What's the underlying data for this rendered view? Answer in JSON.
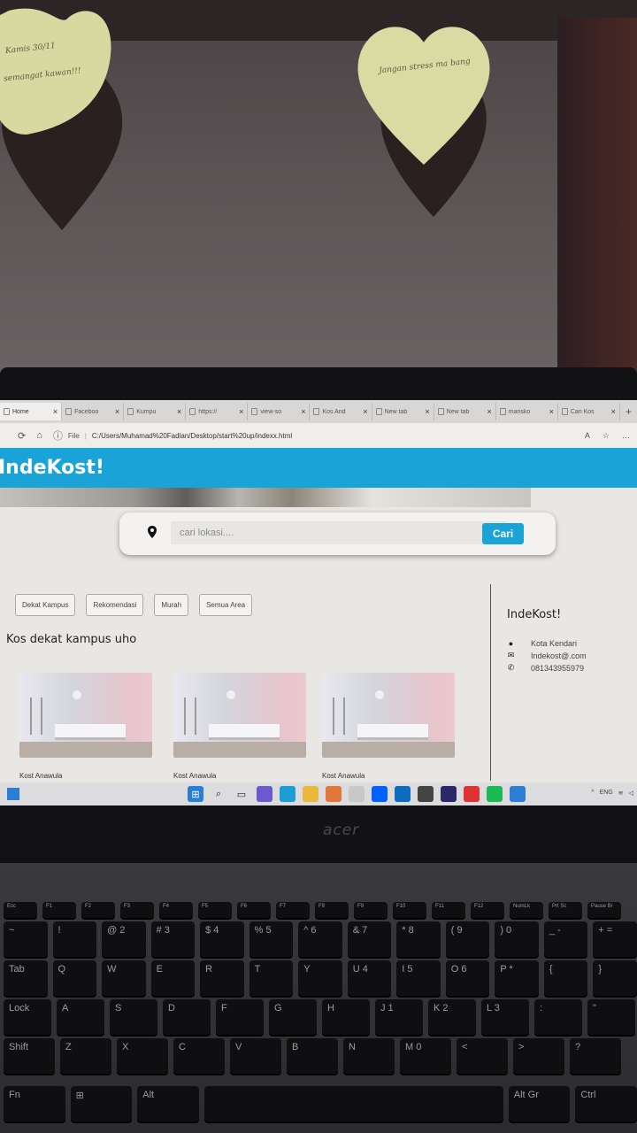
{
  "wall": {
    "note_left_line1": "Kamis 30/11",
    "note_left_line2": "semangat kawan!!!",
    "note_right": "Jangan stress ma bang"
  },
  "browser": {
    "tabs": [
      {
        "label": "Home",
        "active": true
      },
      {
        "label": "Faceboo"
      },
      {
        "label": "Kumpu"
      },
      {
        "label": "https://"
      },
      {
        "label": "view-so"
      },
      {
        "label": "Kos And"
      },
      {
        "label": "New tab"
      },
      {
        "label": "New tab"
      },
      {
        "label": "mansko"
      },
      {
        "label": "Cari Kos"
      }
    ],
    "new_tab_symbol": "+",
    "close_symbol": "×",
    "address": {
      "scheme_label": "File",
      "url": "C:/Users/Muhamad%20Fadlan/Desktop/start%20up/indexx.html"
    }
  },
  "site": {
    "brand": "IndeKost!",
    "search": {
      "placeholder": "cari lokasi....",
      "button": "Cari"
    },
    "filters": [
      "Dekat Kampus",
      "Rekomendasi",
      "Murah",
      "Semua Area"
    ],
    "section_title": "Kos dekat kampus uho",
    "cards": [
      {
        "name": "Kost Anawula"
      },
      {
        "name": "Kost Anawula"
      },
      {
        "name": "Kost Anawula"
      }
    ],
    "sidebar": {
      "brand": "IndeKost!",
      "location": "Kota Kendari",
      "email": "Indekost@.com",
      "phone": "081343955979"
    }
  },
  "taskbar": {
    "tray_lang": "ENG"
  },
  "laptop": {
    "logo": "acer",
    "keys_fn": [
      "Esc",
      "F1",
      "F2",
      "F3",
      "F4",
      "F5",
      "F6",
      "F7",
      "F8",
      "F9",
      "F10",
      "F11",
      "F12",
      "NumLk",
      "Prt Sc",
      "Pause Br"
    ],
    "keys_row1": [
      "~",
      "!",
      "@ 2",
      "# 3",
      "$ 4",
      "% 5",
      "^ 6",
      "& 7",
      "* 8",
      "( 9",
      ") 0",
      "_ -",
      "+ ="
    ],
    "keys_row2": [
      "Tab",
      "Q",
      "W",
      "E",
      "R",
      "T",
      "Y",
      "U 4",
      "I 5",
      "O 6",
      "P *",
      "{",
      "}"
    ],
    "keys_row3": [
      "Lock",
      "A",
      "S",
      "D",
      "F",
      "G",
      "H",
      "J 1",
      "K 2",
      "L 3",
      ":",
      "\""
    ],
    "keys_row4": [
      "Shift",
      "Z",
      "X",
      "C",
      "V",
      "B",
      "N",
      "M 0",
      "<",
      ">",
      "?"
    ],
    "keys_row5": [
      "Fn",
      "⊞",
      "Alt",
      "",
      "Alt Gr",
      "Ctrl"
    ]
  }
}
